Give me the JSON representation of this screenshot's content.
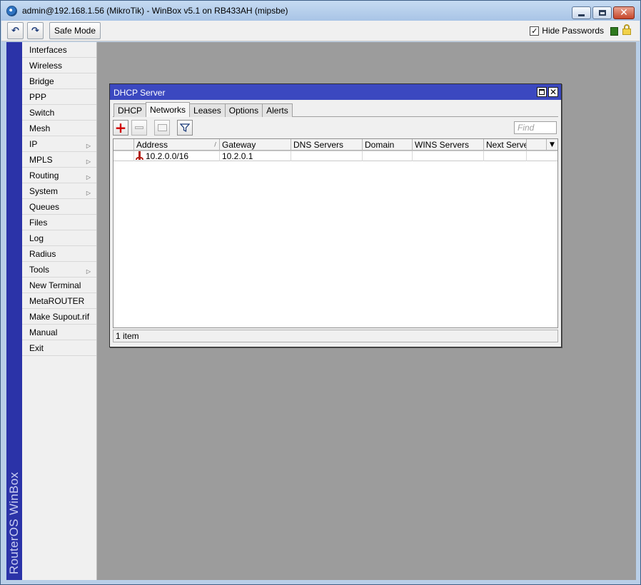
{
  "window": {
    "title": "admin@192.168.1.56 (MikroTik) - WinBox v5.1 on RB433AH (mipsbe)",
    "controls": {
      "minimize_icon": "minimize-icon",
      "maximize_icon": "maximize-icon",
      "close_icon": "close-icon",
      "close_glyph": "✕"
    }
  },
  "toolbar": {
    "undo_glyph": "↶",
    "redo_glyph": "↷",
    "safe_mode_label": "Safe Mode",
    "hide_passwords_label": "Hide Passwords",
    "hide_passwords_checked": true,
    "check_glyph": "✓",
    "status_color": "#2f7a1f"
  },
  "brand": {
    "text": "RouterOS WinBox",
    "color": "#2b33a8"
  },
  "sidebar": {
    "items": [
      {
        "label": "Interfaces",
        "has_submenu": false
      },
      {
        "label": "Wireless",
        "has_submenu": false
      },
      {
        "label": "Bridge",
        "has_submenu": false
      },
      {
        "label": "PPP",
        "has_submenu": false
      },
      {
        "label": "Switch",
        "has_submenu": false
      },
      {
        "label": "Mesh",
        "has_submenu": false
      },
      {
        "label": "IP",
        "has_submenu": true
      },
      {
        "label": "MPLS",
        "has_submenu": true
      },
      {
        "label": "Routing",
        "has_submenu": true
      },
      {
        "label": "System",
        "has_submenu": true
      },
      {
        "label": "Queues",
        "has_submenu": false
      },
      {
        "label": "Files",
        "has_submenu": false
      },
      {
        "label": "Log",
        "has_submenu": false
      },
      {
        "label": "Radius",
        "has_submenu": false
      },
      {
        "label": "Tools",
        "has_submenu": true
      },
      {
        "label": "New Terminal",
        "has_submenu": false
      },
      {
        "label": "MetaROUTER",
        "has_submenu": false
      },
      {
        "label": "Make Supout.rif",
        "has_submenu": false
      },
      {
        "label": "Manual",
        "has_submenu": false
      },
      {
        "label": "Exit",
        "has_submenu": false
      }
    ],
    "submenu_glyph": "▷"
  },
  "dhcp_window": {
    "title": "DHCP Server",
    "close_glyph": "✕",
    "tabs": [
      {
        "label": "DHCP",
        "active": false
      },
      {
        "label": "Networks",
        "active": true
      },
      {
        "label": "Leases",
        "active": false
      },
      {
        "label": "Options",
        "active": false
      },
      {
        "label": "Alerts",
        "active": false
      }
    ],
    "toolbar": {
      "add_glyph": "+",
      "add_color": "#d00000",
      "find_placeholder": "Find"
    },
    "table": {
      "columns": [
        "Address",
        "Gateway",
        "DNS Servers",
        "Domain",
        "WINS Servers",
        "Next Server"
      ],
      "sort_glyph": "/",
      "column_menu_glyph": "▼",
      "rows": [
        {
          "address": "10.2.0.0/16",
          "gateway": "10.2.0.1",
          "dns_servers": "",
          "domain": "",
          "wins_servers": "",
          "next_server": ""
        }
      ]
    },
    "status": "1 item",
    "title_color": "#3b48c0"
  }
}
